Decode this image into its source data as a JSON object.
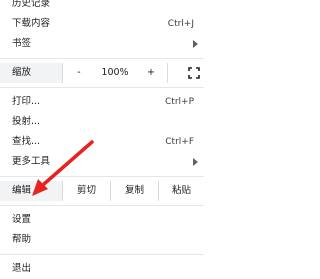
{
  "menu": {
    "history": {
      "label": "历史记录"
    },
    "downloads": {
      "label": "下载内容",
      "shortcut": "Ctrl+J"
    },
    "bookmarks": {
      "label": "书签"
    },
    "zoom": {
      "label": "缩放",
      "minus": "-",
      "value": "100%",
      "plus": "+"
    },
    "print": {
      "label": "打印...",
      "shortcut": "Ctrl+P"
    },
    "cast": {
      "label": "投射..."
    },
    "find": {
      "label": "查找...",
      "shortcut": "Ctrl+F"
    },
    "more_tools": {
      "label": "更多工具"
    },
    "edit": {
      "label": "编辑",
      "cut": "剪切",
      "copy": "复制",
      "paste": "粘贴"
    },
    "settings": {
      "label": "设置"
    },
    "help": {
      "label": "帮助"
    },
    "exit": {
      "label": "退出"
    }
  },
  "annotation": {
    "color": "#e8231f"
  },
  "icons": {
    "fullscreen": "fullscreen-icon",
    "submenu": "chevron-right-icon"
  }
}
